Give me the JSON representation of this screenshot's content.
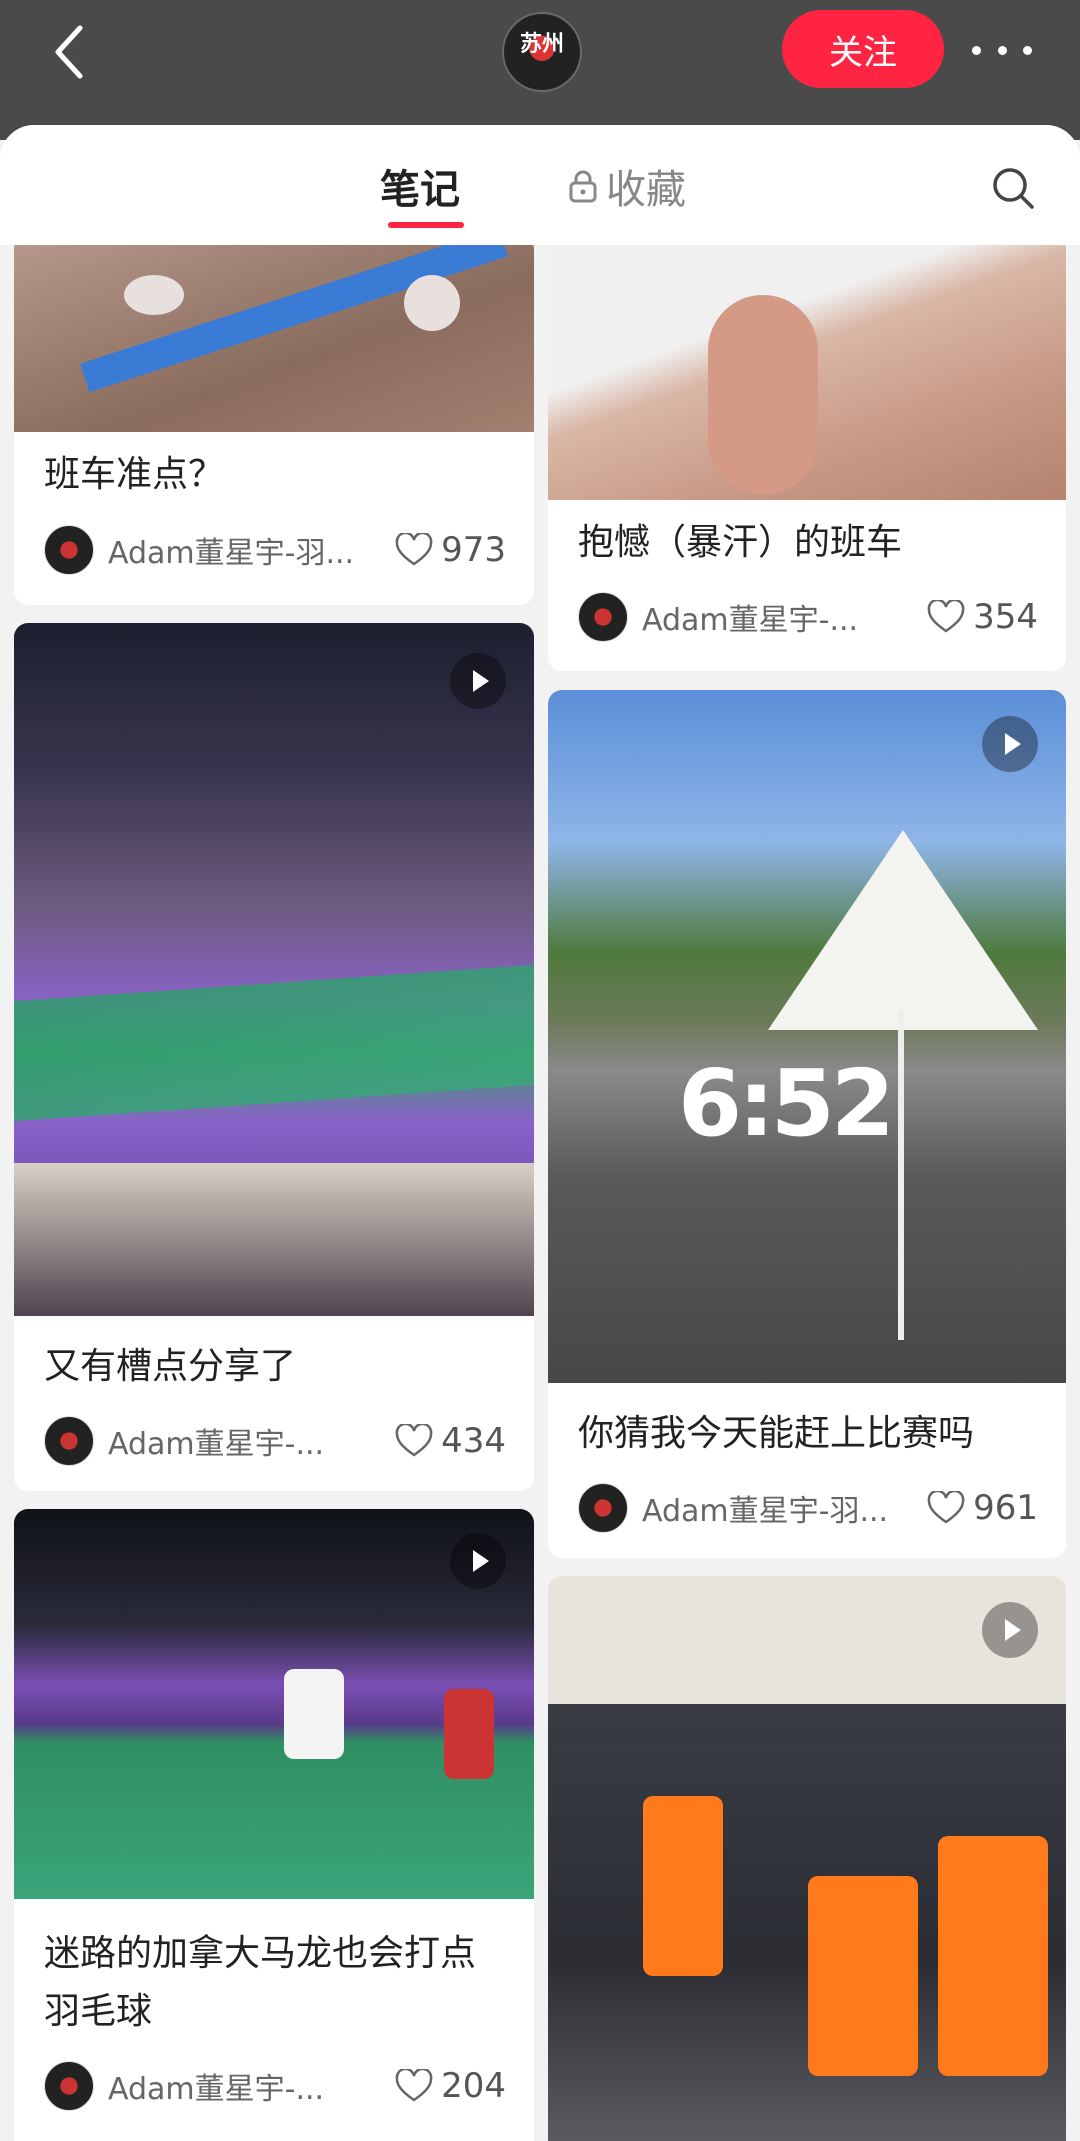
{
  "header": {
    "avatar_text": "苏州",
    "follow_label": "关注"
  },
  "tabs": {
    "notes_label": "笔记",
    "favorites_label": "收藏"
  },
  "feed": {
    "left": [
      {
        "title": "班车准点？",
        "author": "Adam董星宇-羽...",
        "likes": "973",
        "icon": "none"
      },
      {
        "title": "又有槽点分享了",
        "author": "Adam董星宇-...",
        "likes": "434",
        "icon": "play-icon"
      },
      {
        "title": "迷路的加拿大马龙也会打点羽毛球",
        "author": "Adam董星宇-...",
        "likes": "204",
        "icon": "play-icon"
      }
    ],
    "right": [
      {
        "title": "抱憾（暴汗）的班车",
        "author": "Adam董星宇-...",
        "likes": "354",
        "icon": "none"
      },
      {
        "title": "你猜我今天能赶上比赛吗",
        "author": "Adam董星宇-羽...",
        "likes": "961",
        "icon": "play-icon",
        "overlay": "6:52"
      },
      {
        "title": "",
        "author": "",
        "likes": "",
        "icon": "play-icon"
      }
    ]
  },
  "icons": [
    "back-arrow-icon",
    "more-dots-icon",
    "lock-icon",
    "search-icon",
    "heart-icon",
    "play-icon"
  ],
  "colors": {
    "accent": "#ff2442",
    "topbar": "#4a4a4a"
  }
}
